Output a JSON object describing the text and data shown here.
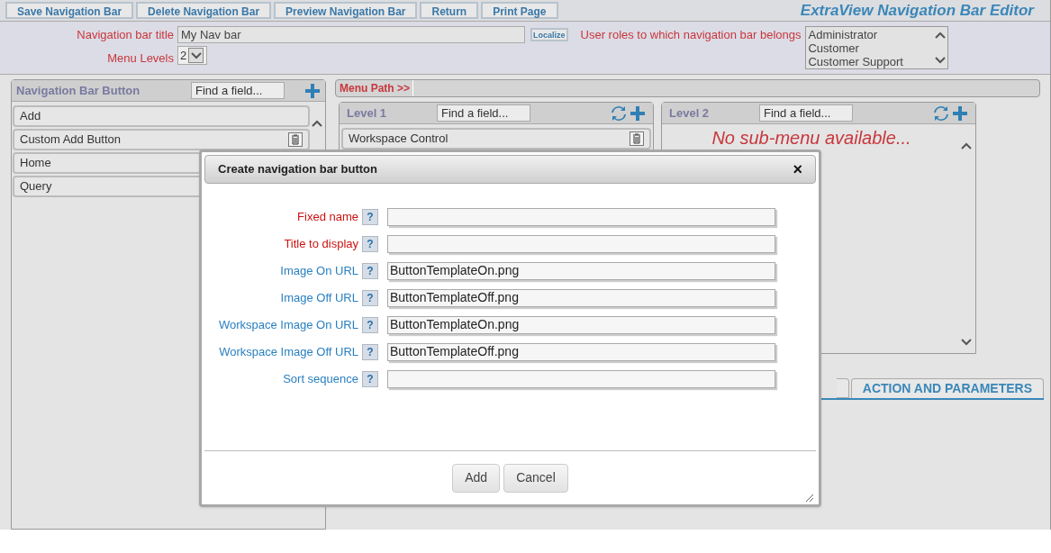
{
  "toolbar": {
    "buttons": [
      "Save Navigation Bar",
      "Delete Navigation Bar",
      "Preview Navigation Bar",
      "Return",
      "Print Page"
    ],
    "title": "ExtraView Navigation Bar Editor"
  },
  "header": {
    "title_label": "Navigation bar title",
    "title_value": "My Nav bar",
    "localize_button": "Localize",
    "levels_label": "Menu Levels",
    "levels_value": "2",
    "roles_label": "User roles to which navigation bar belongs",
    "roles": [
      "Administrator",
      "Customer",
      "Customer Support"
    ]
  },
  "button_panel": {
    "title": "Navigation Bar Button",
    "search": {
      "placeholder": "Find a field..."
    },
    "items": [
      {
        "label": "Add",
        "deletable": false
      },
      {
        "label": "Custom Add Button",
        "deletable": true
      },
      {
        "label": "Home"
      },
      {
        "label": "Query"
      }
    ]
  },
  "menu_path": {
    "label": "Menu Path >>"
  },
  "levels": [
    {
      "title": "Level 1",
      "search": {
        "placeholder": "Find a field..."
      },
      "items": [
        {
          "label": "Workspace Control",
          "deletable": true
        }
      ]
    },
    {
      "title": "Level 2",
      "search": {
        "placeholder": "Find a field..."
      },
      "empty_message": "No sub-menu available..."
    }
  ],
  "tabs": [
    {
      "label": "ACTION AND PARAMETERS",
      "selected": true
    }
  ],
  "dialog": {
    "title": "Create navigation bar button",
    "close": "×",
    "fields": [
      {
        "label": "Fixed name",
        "required": true,
        "help": "?"
      },
      {
        "label": "Title to display",
        "required": true,
        "help": "?"
      },
      {
        "label": "Image On URL",
        "required": false,
        "help": "?",
        "value": "ButtonTemplateOn.png"
      },
      {
        "label": "Image Off URL",
        "required": false,
        "help": "?",
        "value": "ButtonTemplateOff.png"
      },
      {
        "label": "Workspace Image On URL",
        "required": false,
        "help": "?",
        "value": "ButtonTemplateOn.png"
      },
      {
        "label": "Workspace Image Off URL",
        "required": false,
        "help": "?",
        "value": "ButtonTemplateOff.png"
      },
      {
        "label": "Sort sequence",
        "required": false,
        "help": "?"
      }
    ],
    "buttons": [
      "Add",
      "Cancel"
    ]
  }
}
